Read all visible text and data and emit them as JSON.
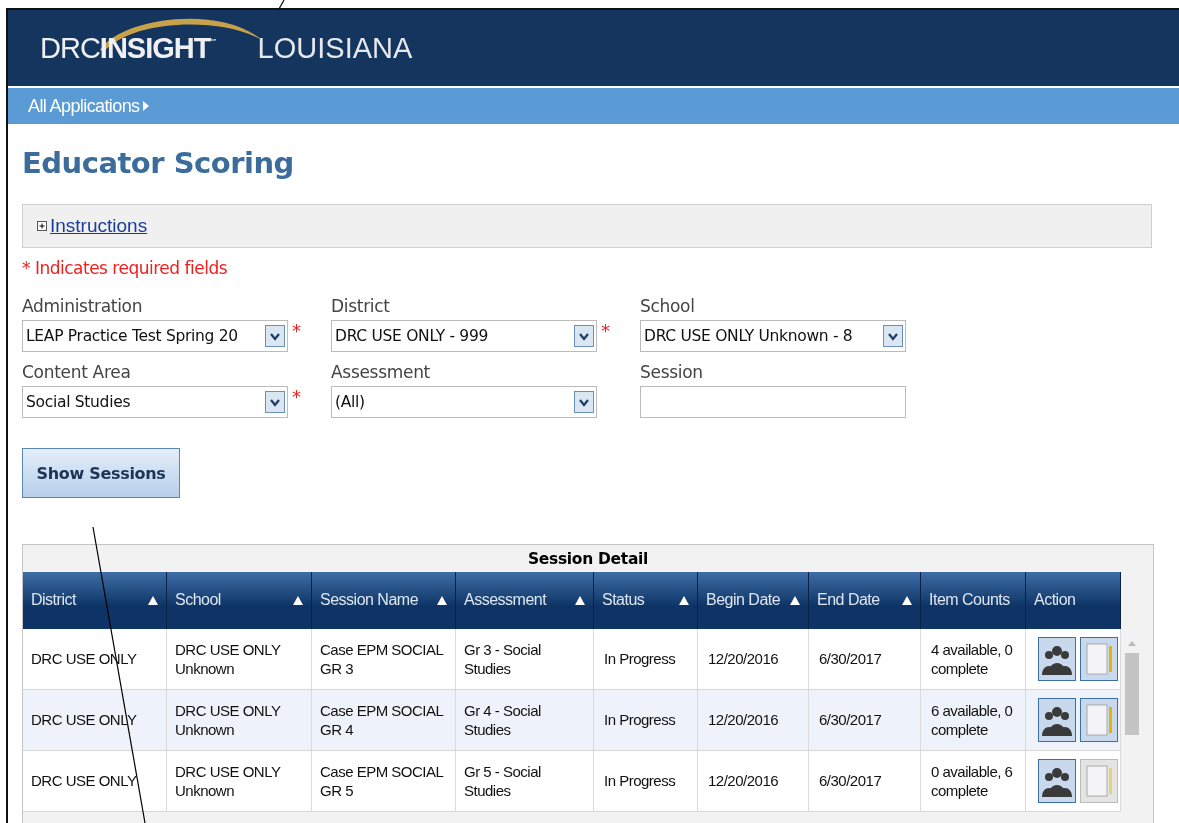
{
  "header": {
    "logo": {
      "light": "DRC",
      "bold": "INSIGHT",
      "mark": "℠"
    },
    "state": "LOUISIANA"
  },
  "nav": {
    "label": "All Applications"
  },
  "page_title": "Educator Scoring",
  "instructions": {
    "label": "Instructions",
    "expanded": false
  },
  "required_note": "* Indicates required fields",
  "fields": [
    {
      "label": "Administration",
      "kind": "select",
      "value": "LEAP Practice Test Spring 20",
      "required": true
    },
    {
      "label": "District",
      "kind": "select",
      "value": "DRC USE ONLY - 999",
      "required": true
    },
    {
      "label": "School",
      "kind": "select",
      "value": "DRC USE ONLY Unknown - 8",
      "required": false
    },
    {
      "label": "Content Area",
      "kind": "select",
      "value": "Social Studies",
      "required": true
    },
    {
      "label": "Assessment",
      "kind": "select",
      "value": "(All)",
      "required": false
    },
    {
      "label": "Session",
      "kind": "text",
      "required": false
    }
  ],
  "required_mark": "*",
  "show_button": "Show Sessions",
  "table": {
    "title": "Session Detail",
    "columns": [
      {
        "label": "District",
        "sortable": true
      },
      {
        "label": "School",
        "sortable": true
      },
      {
        "label": "Session Name",
        "sortable": true
      },
      {
        "label": "Assessment",
        "sortable": true
      },
      {
        "label": "Status",
        "sortable": true
      },
      {
        "label": "Begin Date",
        "sortable": true
      },
      {
        "label": "End Date",
        "sortable": true
      },
      {
        "label": "Item Counts",
        "sortable": false
      },
      {
        "label": "Action",
        "sortable": false
      }
    ],
    "rows": [
      {
        "cells": [
          "DRC USE ONLY",
          "DRC USE ONLY Unknown",
          "Case EPM SOCIAL GR 3",
          "Gr 3 - Social Studies",
          "In Progress",
          "12/20/2016",
          "6/30/2017",
          "4 available, 0 complete"
        ],
        "score_enabled": true
      },
      {
        "cells": [
          "DRC USE ONLY",
          "DRC USE ONLY Unknown",
          "Case EPM SOCIAL GR 4",
          "Gr 4 - Social Studies",
          "In Progress",
          "12/20/2016",
          "6/30/2017",
          "6 available, 0 complete"
        ],
        "score_enabled": true
      },
      {
        "cells": [
          "DRC USE ONLY",
          "DRC USE ONLY Unknown",
          "Case EPM SOCIAL GR 5",
          "Gr 5 - Social Studies",
          "In Progress",
          "12/20/2016",
          "6/30/2017",
          "0 available, 6 complete"
        ],
        "score_enabled": false
      }
    ]
  }
}
